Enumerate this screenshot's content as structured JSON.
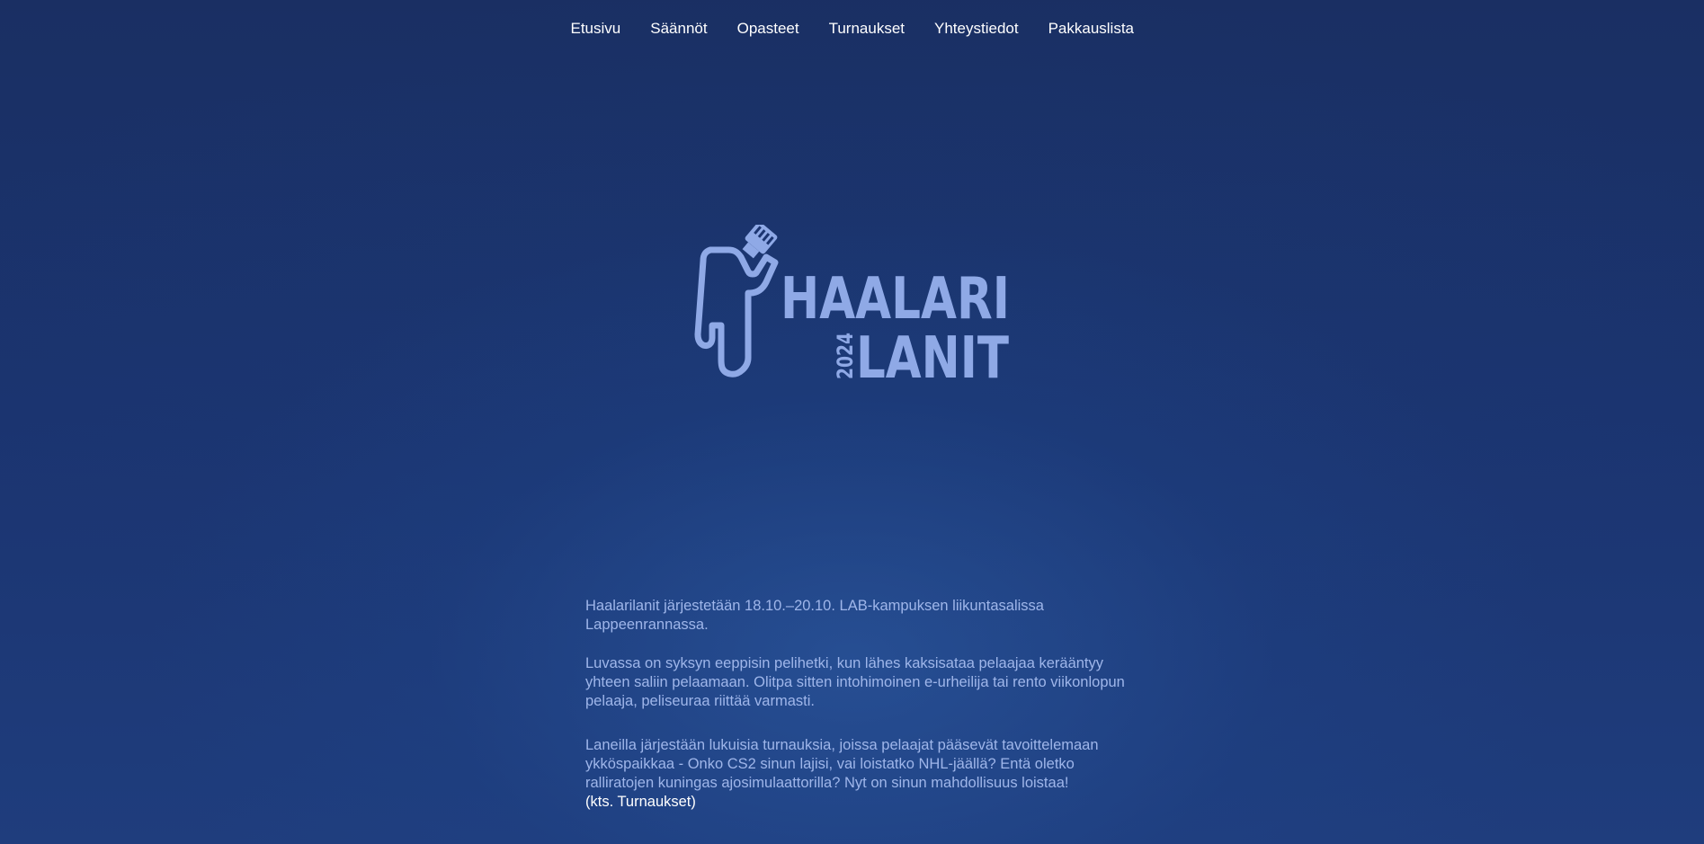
{
  "nav": {
    "items": [
      {
        "label": "Etusivu"
      },
      {
        "label": "Säännöt"
      },
      {
        "label": "Opasteet"
      },
      {
        "label": "Turnaukset"
      },
      {
        "label": "Yhteystiedot"
      },
      {
        "label": "Pakkauslista"
      }
    ]
  },
  "logo": {
    "line1": "HAALARI",
    "line2": "LANIT",
    "year": "2024",
    "icon": "person-with-ethernet-cable-icon",
    "color": "#8fa9e6"
  },
  "content": {
    "paragraph1": "Haalarilanit järjestetään 18.10.–20.10. LAB-kampuksen liikuntasalissa Lappeenrannassa.",
    "paragraph2": "Luvassa on syksyn eeppisin pelihetki, kun lähes kaksisataa pelaajaa kerääntyy yhteen saliin pelaamaan. Olitpa sitten intohimoinen e-urheilija tai rento viikonlopun pelaaja, peliseuraa riittää varmasti.",
    "paragraph3": "Laneilla järjestään lukuisia turnauksia, joissa pelaajat pääsevät tavoittelemaan ykköspaikkaa - Onko CS2 sinun lajisi, vai loistatko NHL-jäällä? Entä oletko ralliratojen kuningas ajosimulaattorilla? Nyt on sinun mahdollisuus loistaa!",
    "link": "(kts. Turnaukset)"
  },
  "colors": {
    "background": "#1b3470",
    "text": "#9fb6ea",
    "nav_text": "#ffffff"
  }
}
